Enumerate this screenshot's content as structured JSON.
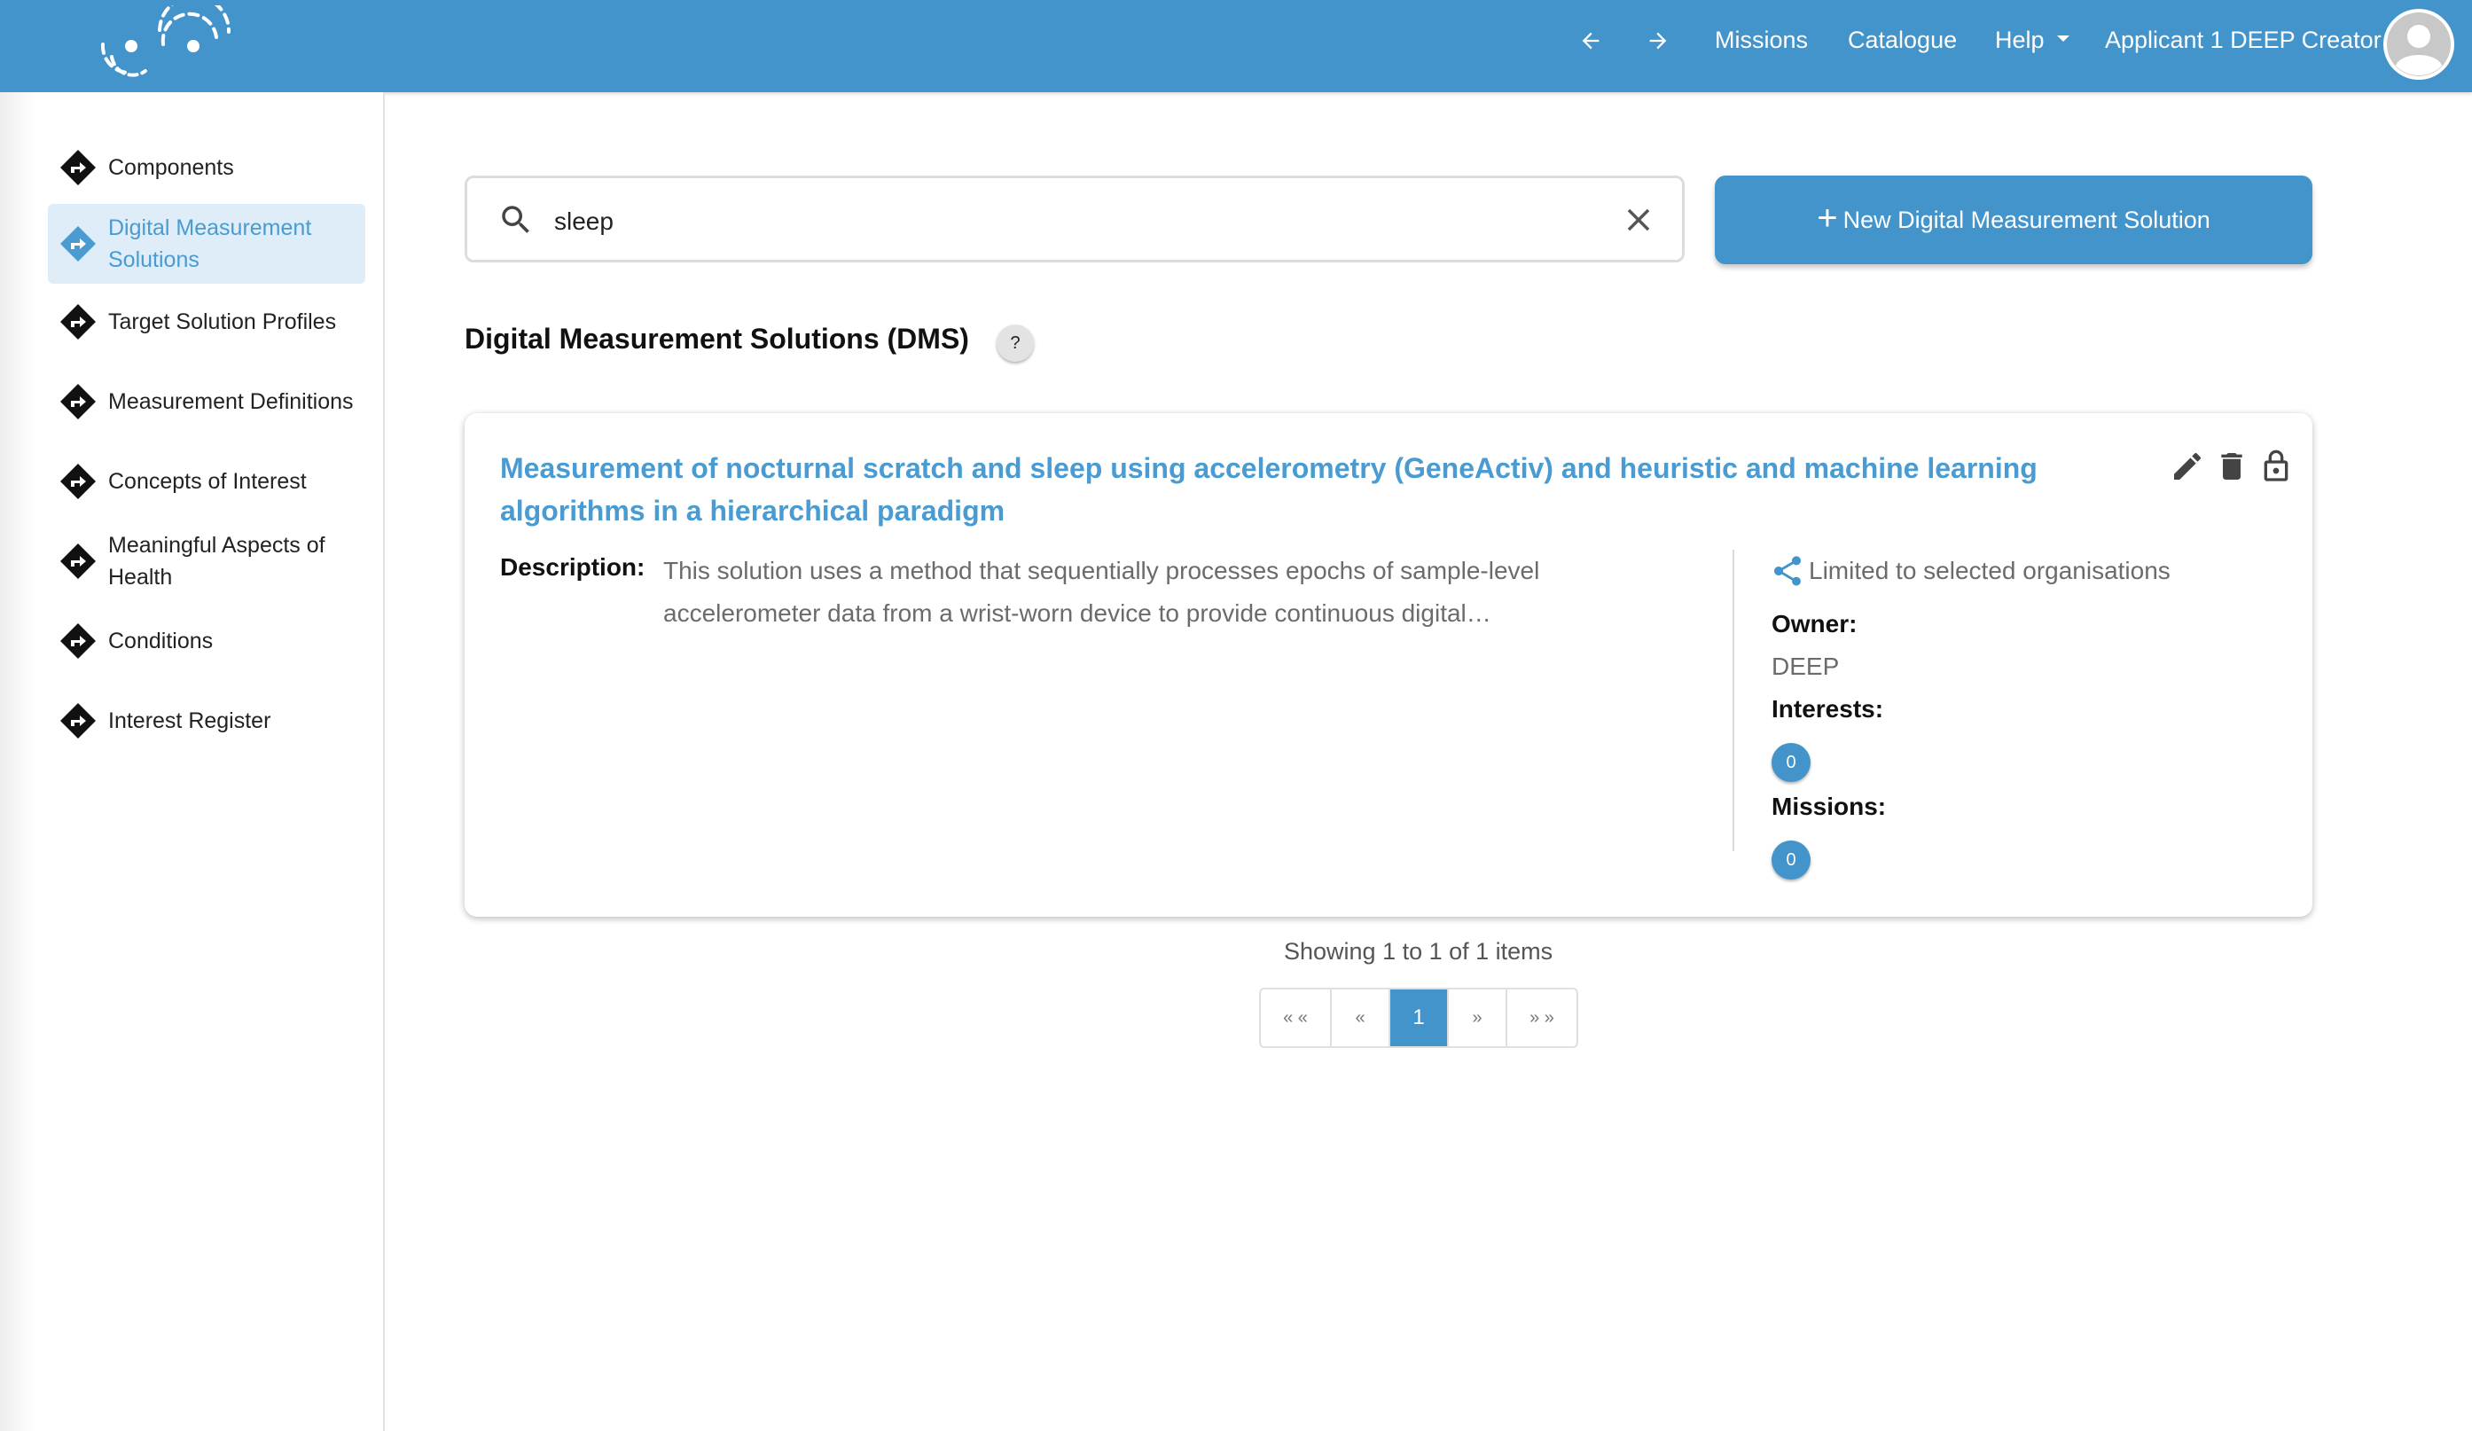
{
  "header": {
    "back_icon": "arrow-left-icon",
    "forward_icon": "arrow-right-icon",
    "nav": {
      "missions": "Missions",
      "catalogue": "Catalogue",
      "help": "Help",
      "user": "Applicant 1 DEEP Creator"
    },
    "bar_color": "#4394cb"
  },
  "sidebar": {
    "items": [
      {
        "label": "Components"
      },
      {
        "label": "Digital Measurement Solutions",
        "active": true
      },
      {
        "label": "Target Solution Profiles"
      },
      {
        "label": "Measurement Definitions"
      },
      {
        "label": "Concepts of Interest"
      },
      {
        "label": "Meaningful Aspects of Health"
      },
      {
        "label": "Conditions"
      },
      {
        "label": "Interest Register"
      }
    ],
    "active_color": "#4a9bd1",
    "active_bg": "#deedf7"
  },
  "search": {
    "value": "sleep",
    "search_icon": "search-icon",
    "clear_icon": "close-icon"
  },
  "new_button": {
    "label": "New Digital Measurement Solution",
    "plus": "+"
  },
  "page": {
    "title": "Digital Measurement Solutions (DMS)",
    "help": "?"
  },
  "results": [
    {
      "title": "Measurement of nocturnal scratch and sleep using accelerometry (GeneActiv) and heuristic and machine learning algorithms in a hierarchical paradigm",
      "description_label": "Description:",
      "description": "This solution uses a method that sequentially processes epochs of sample-level accelerometer data from a wrist-worn device to provide continuous digital…",
      "sharing": "Limited to selected organisations",
      "owner_label": "Owner:",
      "owner": "DEEP",
      "interests_label": "Interests:",
      "interests": "0",
      "missions_label": "Missions:",
      "missions": "0",
      "actions": [
        "pencil-icon",
        "trash-icon",
        "unlock-icon"
      ]
    }
  ],
  "pagination": {
    "summary": "Showing 1 to 1 of 1 items",
    "first": "« «",
    "prev": "«",
    "current": "1",
    "next": "»",
    "last": "» »"
  }
}
